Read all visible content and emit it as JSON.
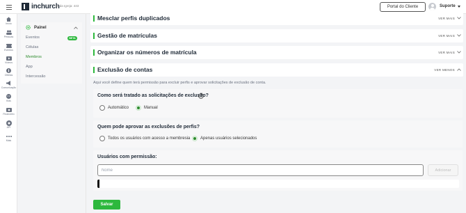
{
  "header": {
    "brand": "inchurch",
    "church_id": "ID da Igreja: 443",
    "portal_button": "Portal do Cliente",
    "user_name": "Suporte"
  },
  "rail": {
    "items": [
      {
        "label": "Início",
        "icon": "home-icon"
      },
      {
        "label": "Pessoas",
        "icon": "people-icon"
      },
      {
        "label": "Eventos",
        "icon": "ticket-icon"
      },
      {
        "label": "Vídeos",
        "icon": "video-icon"
      },
      {
        "label": "Ofertas",
        "icon": "offer-icon"
      },
      {
        "label": "Comunicação",
        "icon": "megaphone-icon"
      },
      {
        "label": "Kids",
        "icon": "kids-icon"
      },
      {
        "label": "Financeiro",
        "icon": "finance-icon"
      },
      {
        "label": "API",
        "icon": "api-icon"
      },
      {
        "label": "Mais",
        "icon": "more-icon"
      }
    ]
  },
  "submenu": {
    "title": "Painel",
    "beta_badge": "BETA",
    "items": [
      "Eventos",
      "Células",
      "Membros",
      "App",
      "Intercessão"
    ],
    "active_item": "Membros"
  },
  "sections": [
    {
      "title": "Mesclar perfis duplicados",
      "action": "VER MAIS"
    },
    {
      "title": "Gestão de matrículas",
      "action": "VER MAIS"
    },
    {
      "title": "Organizar os números de matrícula",
      "action": "VER MAIS"
    },
    {
      "title": "Exclusão de contas",
      "action": "VER MENOS"
    }
  ],
  "exclusion": {
    "description": "Aqui você define quem terá permissão para excluir perfis e aprovar solicitações de exclusão de conta.",
    "handling": {
      "question": "Como será tratado as solicitações de exclusão?",
      "options": [
        "Automático",
        "Manual"
      ],
      "selected": "Manual"
    },
    "approvers": {
      "question": "Quem pode aprovar as exclusões de perfis?",
      "options": [
        "Todos os usuários com acesso a membresia",
        "Apenas usuários selecionados"
      ],
      "selected": "Apenas usuários selecionados"
    },
    "users": {
      "title": "Usuários com permissão:",
      "input_placeholder": "Nome",
      "add_button": "Adicionar"
    }
  },
  "save_button": "Salvar",
  "colors": {
    "accent": "#2db83d",
    "accent_text": "#2e8b2e"
  }
}
